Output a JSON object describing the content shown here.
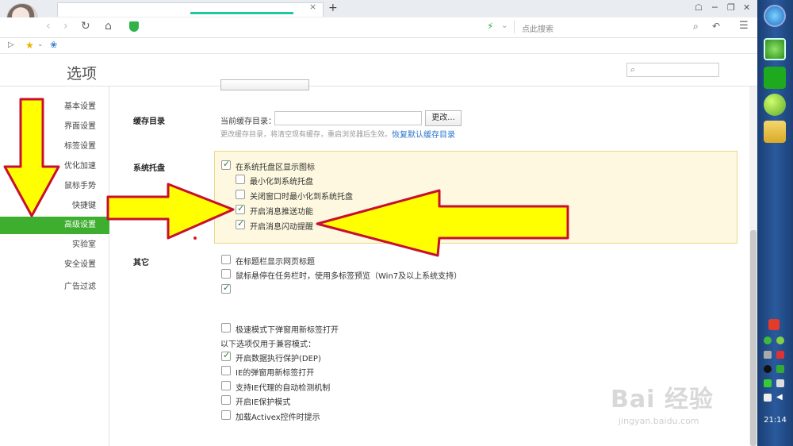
{
  "browser": {
    "new_tab": "+",
    "tab_close": "×",
    "search_placeholder": "点此搜索"
  },
  "page": {
    "title": "选项",
    "search_icon": "search-icon"
  },
  "sidebar": {
    "items": [
      {
        "label": "基本设置"
      },
      {
        "label": "界面设置"
      },
      {
        "label": "标签设置"
      },
      {
        "label": "优化加速"
      },
      {
        "label": "鼠标手势"
      },
      {
        "label": "快捷键"
      },
      {
        "label": "高级设置",
        "active": true
      },
      {
        "label": "实验室"
      },
      {
        "label": "安全设置"
      },
      {
        "label": "广告过滤"
      }
    ]
  },
  "cache": {
    "section_label": "缓存目录",
    "current_label": "当前缓存目录：",
    "change_button": "更改...",
    "note": "更改缓存目录，将清空现有缓存，重启浏览器后生效。",
    "restore_link": "恢复默认缓存目录"
  },
  "tray": {
    "section_label": "系统托盘",
    "options": [
      {
        "label": "在系统托盘区显示图标",
        "checked": true
      },
      {
        "label": "最小化到系统托盘",
        "checked": false
      },
      {
        "label": "关闭窗口时最小化到系统托盘",
        "checked": false
      },
      {
        "label": "开启消息推送功能",
        "checked": true
      },
      {
        "label": "开启消息闪动提醒",
        "checked": true
      }
    ]
  },
  "other": {
    "section_label": "其它",
    "options": [
      {
        "label": "在标题栏显示网页标题",
        "checked": false
      },
      {
        "label": "鼠标悬停在任务栏时，使用多标签预览（Win7及以上系统支持）",
        "checked": false
      },
      {
        "label": "",
        "checked": true
      },
      {
        "label": "极速模式下弹窗用新标签打开",
        "checked": false
      }
    ],
    "compat_heading": "以下选项仅用于兼容模式：",
    "compat_options": [
      {
        "label": "开启数据执行保护(DEP)",
        "checked": true
      },
      {
        "label": "IE的弹窗用新标签打开",
        "checked": false
      },
      {
        "label": "支持IE代理的自动检测机制",
        "checked": false
      },
      {
        "label": "开启IE保护模式",
        "checked": false
      },
      {
        "label": "加载Activex控件时提示",
        "checked": false
      }
    ]
  },
  "watermark": {
    "main": "Bai 经验",
    "sub": "jingyan.baidu.com"
  },
  "taskbar": {
    "clock": "21:14"
  },
  "colors": {
    "accent_green": "#3eae2f",
    "arrow_yellow": "#ffff00",
    "arrow_outline": "#c8102e",
    "tray_panel_bg": "#fdf8df"
  }
}
